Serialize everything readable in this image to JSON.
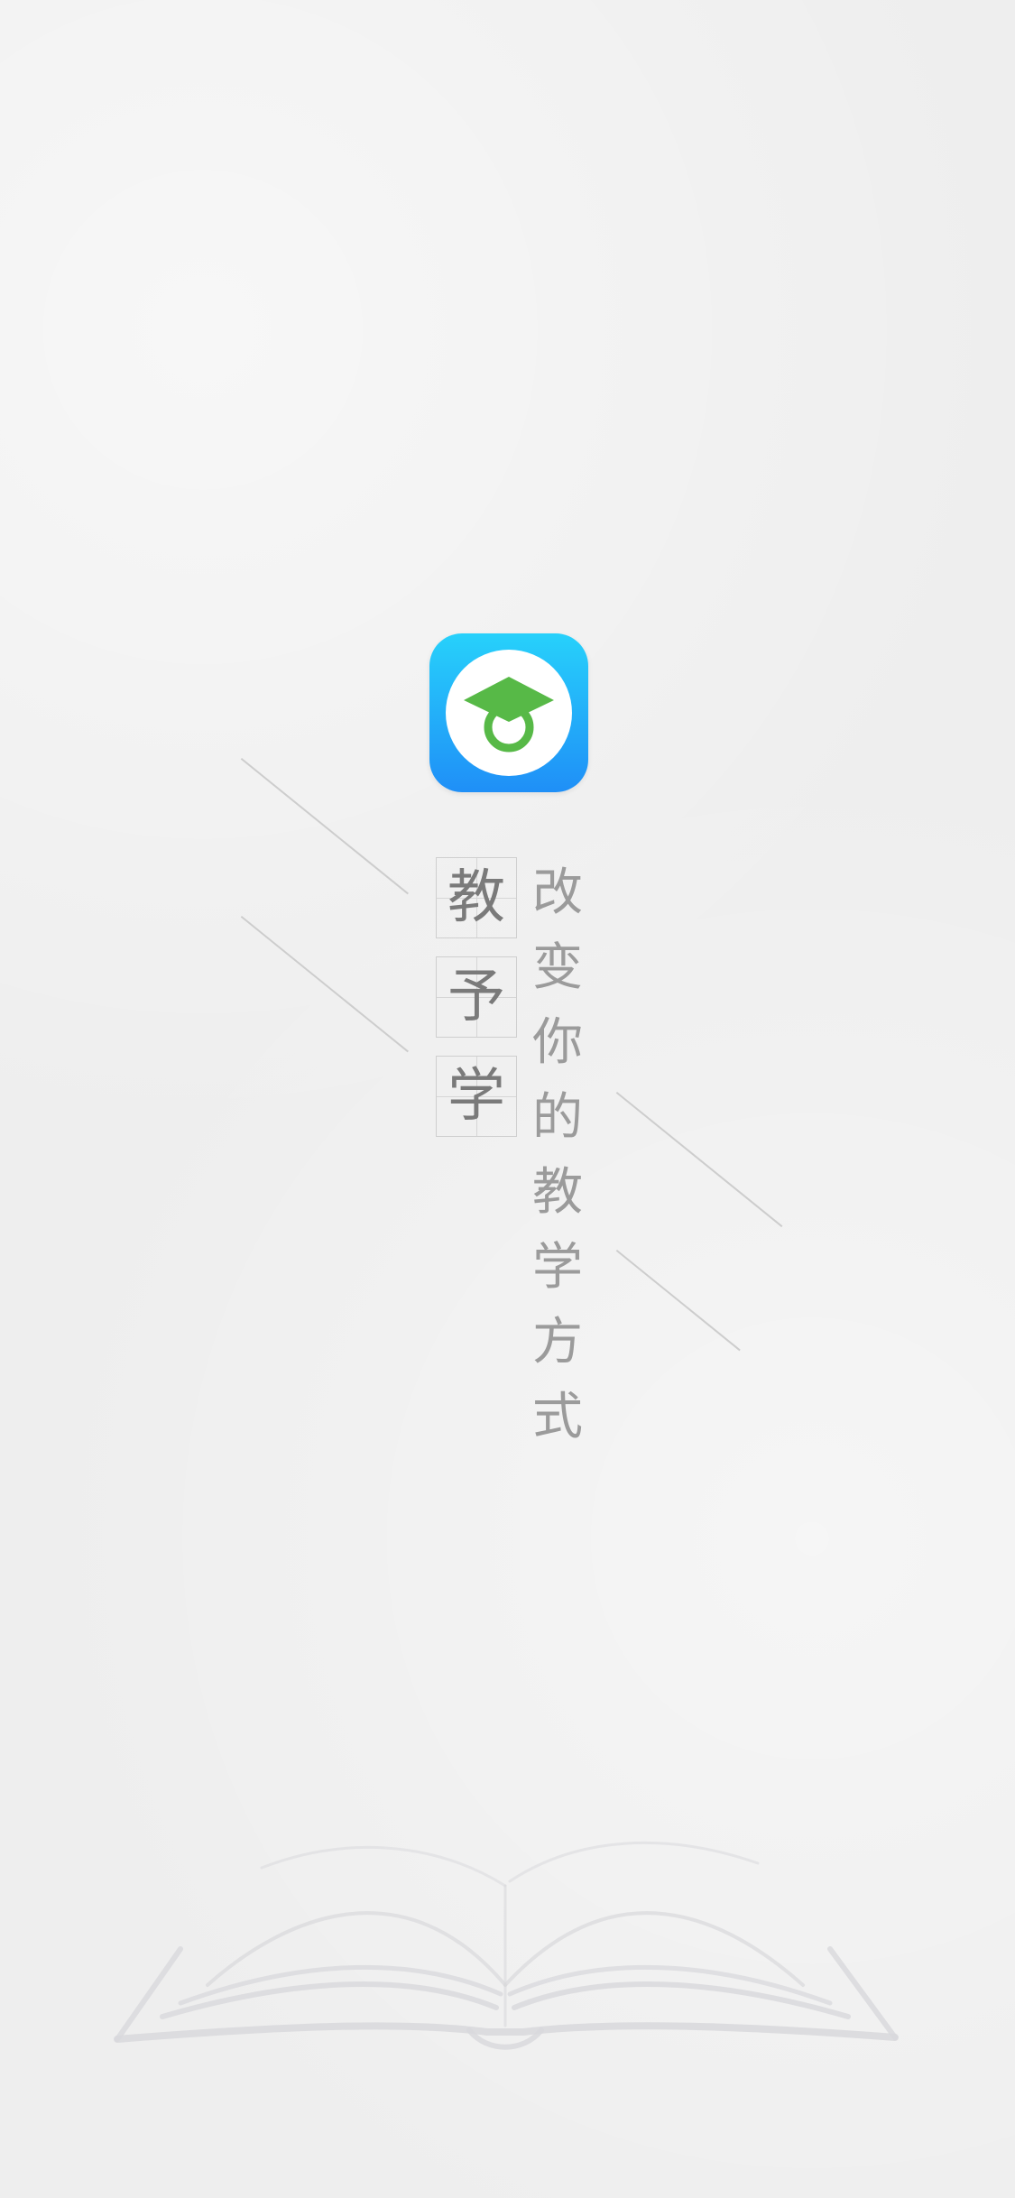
{
  "app": {
    "icon_name": "graduation-cap-icon",
    "colors": {
      "icon_gradient_top": "#27d1fb",
      "icon_gradient_bottom": "#1f8ff7",
      "cap_green": "#57b947",
      "background": "#eeeeee"
    }
  },
  "brand": {
    "chars": [
      "教",
      "予",
      "学"
    ]
  },
  "slogan": {
    "chars": [
      "改",
      "变",
      "你",
      "的",
      "教",
      "学",
      "方",
      "式"
    ]
  },
  "decoration": {
    "book_icon": "open-book-icon"
  }
}
